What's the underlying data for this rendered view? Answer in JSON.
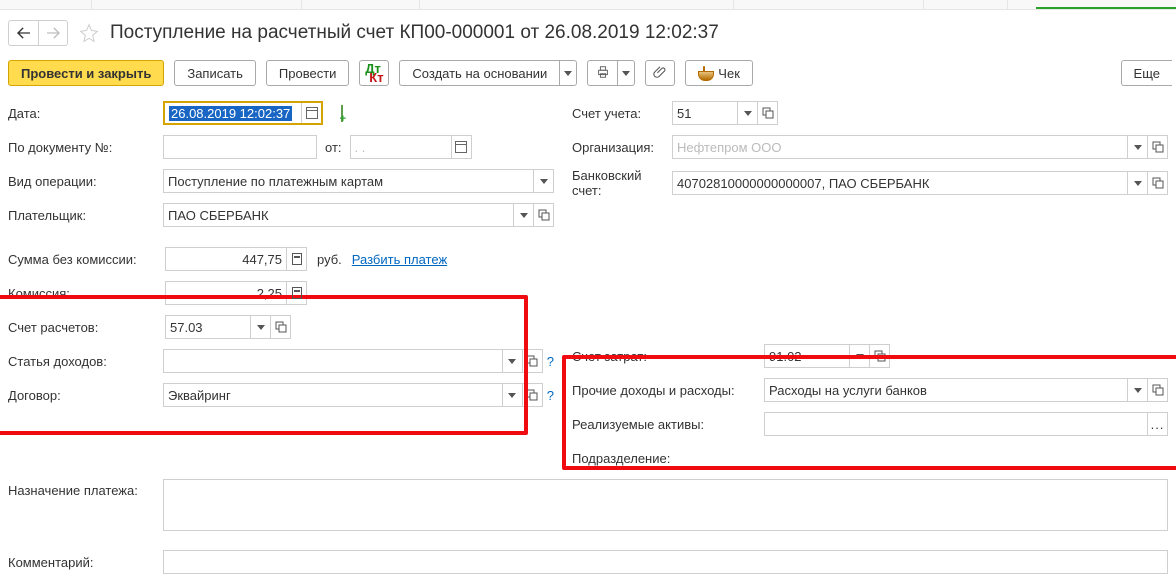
{
  "header": {
    "title": "Поступление на расчетный счет КП00-000001 от 26.08.2019 12:02:37"
  },
  "toolbar": {
    "post_close": "Провести и закрыть",
    "save": "Записать",
    "post": "Провести",
    "create_based": "Создать на основании",
    "cheque": "Чек",
    "more": "Еще"
  },
  "left": {
    "date_label": "Дата:",
    "date_value": "26.08.2019 12:02:37",
    "docnum_label": "По документу №:",
    "docnum_value": "",
    "docnum_from": "от:",
    "docnum_date": ".  .",
    "optype_label": "Вид операции:",
    "optype_value": "Поступление по платежным картам",
    "payer_label": "Плательщик:",
    "payer_value": "ПАО СБЕРБАНК",
    "sum_label": "Сумма без комиссии:",
    "sum_value": "447,75",
    "sum_unit": "руб.",
    "split_link": "Разбить платеж",
    "commission_label": "Комиссия:",
    "commission_value": "2,25",
    "settle_acc_label": "Счет расчетов:",
    "settle_acc_value": "57.03",
    "income_label": "Статья доходов:",
    "income_value": "",
    "contract_label": "Договор:",
    "contract_value": "Эквайринг",
    "purpose_label": "Назначение платежа:",
    "purpose_value": "",
    "comment_label": "Комментарий:",
    "comment_value": ""
  },
  "right": {
    "account_label": "Счет учета:",
    "account_value": "51",
    "org_label": "Организация:",
    "org_value": "Нефтепром ООО",
    "bank_label": "Банковский счет:",
    "bank_value": "40702810000000000007, ПАО СБЕРБАНК",
    "cost_acc_label": "Счет затрат:",
    "cost_acc_value": "91.02",
    "other_ie_label": "Прочие доходы и расходы:",
    "other_ie_value": "Расходы на услуги банков",
    "assets_label": "Реализуемые активы:",
    "assets_value": "",
    "dept_label": "Подразделение:",
    "dept_value": ""
  }
}
